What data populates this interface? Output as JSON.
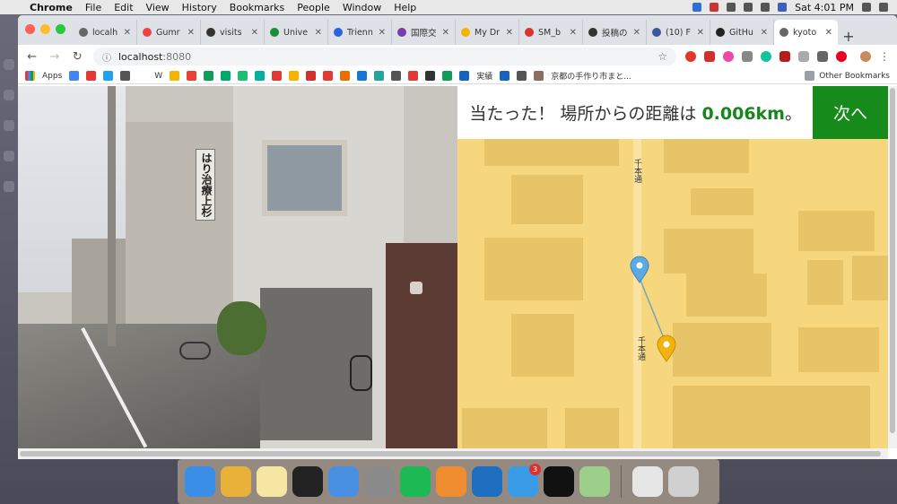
{
  "menubar": {
    "app": "Chrome",
    "items": [
      "File",
      "Edit",
      "View",
      "History",
      "Bookmarks",
      "People",
      "Window",
      "Help"
    ],
    "clock": "Sat 4:01 PM"
  },
  "browser": {
    "tabs": [
      {
        "label": "localh",
        "color": "#666"
      },
      {
        "label": "Gumr",
        "color": "#e44"
      },
      {
        "label": "visits",
        "color": "#333"
      },
      {
        "label": "Unive",
        "color": "#1a8f3a"
      },
      {
        "label": "Trienn",
        "color": "#2a64d8"
      },
      {
        "label": "国際交",
        "color": "#7a3ea8"
      },
      {
        "label": "My Dr",
        "color": "#f4b400"
      },
      {
        "label": "SM_b",
        "color": "#d8342c"
      },
      {
        "label": "投稿の",
        "color": "#333"
      },
      {
        "label": "(10) F",
        "color": "#3b5998"
      },
      {
        "label": "GitHu",
        "color": "#222"
      },
      {
        "label": "kyoto",
        "color": "#666"
      }
    ],
    "url_host": "localhost",
    "url_port": ":8080"
  },
  "bookmarks": {
    "apps_label": "Apps",
    "items": [
      {
        "label": "",
        "color": "#4285f4"
      },
      {
        "label": "",
        "color": "#e53935"
      },
      {
        "label": "",
        "color": "#1da1f2"
      },
      {
        "label": "",
        "color": "#555"
      },
      {
        "label": "W",
        "color": "#fff"
      },
      {
        "label": "",
        "color": "#f4b400"
      },
      {
        "label": "",
        "color": "#e94235"
      },
      {
        "label": "",
        "color": "#0f9d58"
      },
      {
        "label": "",
        "color": "#00a86b"
      },
      {
        "label": "",
        "color": "#1dbf73"
      },
      {
        "label": "",
        "color": "#00b0a0"
      },
      {
        "label": "",
        "color": "#e53935"
      },
      {
        "label": "",
        "color": "#f4b400"
      },
      {
        "label": "",
        "color": "#d32f2f"
      },
      {
        "label": "",
        "color": "#e53935"
      },
      {
        "label": "",
        "color": "#ef6c00"
      },
      {
        "label": "",
        "color": "#1976d2"
      },
      {
        "label": "",
        "color": "#26a69a"
      },
      {
        "label": "",
        "color": "#555"
      },
      {
        "label": "",
        "color": "#e53935"
      },
      {
        "label": "",
        "color": "#333"
      },
      {
        "label": "",
        "color": "#0f9d58"
      },
      {
        "label": "実績",
        "color": "#1565c0"
      },
      {
        "label": "",
        "color": "#1565c0"
      },
      {
        "label": "",
        "color": "#555"
      },
      {
        "label": "京都の手作り市まと...",
        "color": "#8d6e63"
      }
    ],
    "other": "Other Bookmarks"
  },
  "game": {
    "result_prefix": "当たった！ 場所からの距離は ",
    "distance": "0.006km",
    "result_suffix": "。",
    "next_label": "次へ",
    "street_label": "千本通",
    "colors": {
      "accent": "#168a1a",
      "map_bg": "#f7d77d",
      "block": "#e8c468",
      "guess_marker": "#5da9e6",
      "answer_marker": "#f2b30f"
    }
  },
  "streetview": {
    "sign_text": "はり治療上杉"
  },
  "dock": {
    "apps": [
      {
        "name": "finder",
        "color": "#3a8ee6"
      },
      {
        "name": "chrome",
        "color": "#e8b23a"
      },
      {
        "name": "notes",
        "color": "#f5e6a3"
      },
      {
        "name": "activity-monitor",
        "color": "#222"
      },
      {
        "name": "keynote",
        "color": "#4a90e2"
      },
      {
        "name": "system-preferences",
        "color": "#8a8a8a"
      },
      {
        "name": "spotify",
        "color": "#1db954"
      },
      {
        "name": "calculator",
        "color": "#ef8c2f"
      },
      {
        "name": "vscode",
        "color": "#1e6fbf"
      },
      {
        "name": "tweetbot",
        "color": "#3a9be6",
        "badge": "3"
      },
      {
        "name": "terminal",
        "color": "#111"
      },
      {
        "name": "preview",
        "color": "#9bcf8a"
      },
      {
        "name": "itunes",
        "color": "#e6e6e6"
      },
      {
        "name": "trash",
        "color": "#d0d0d0"
      }
    ]
  }
}
